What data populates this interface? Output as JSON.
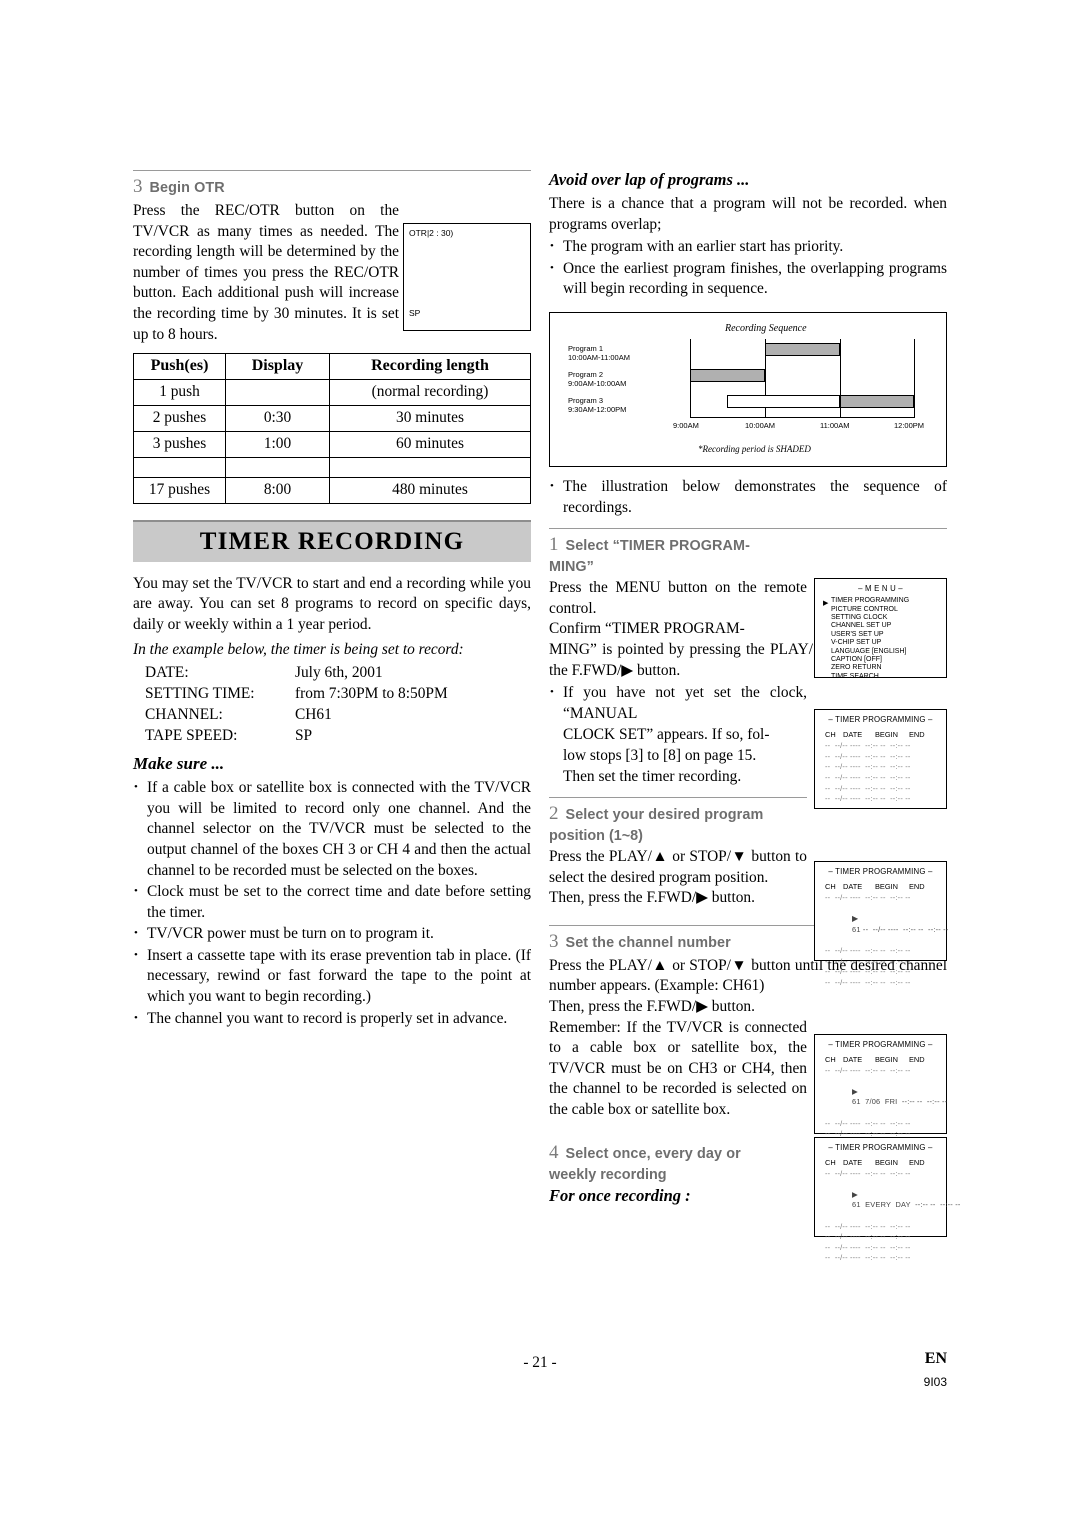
{
  "left": {
    "step3": {
      "num": "3",
      "title": "Begin OTR"
    },
    "step3_body": "Press the REC/OTR button on the TV/VCR as many times as needed. The recording length will be determined by the number of times you press the REC/OTR button. Each additional push will increase the recording time by 30 minutes. It is set up to 8 hours.",
    "otr_display": {
      "top": "OTR|2 : 30)",
      "bottom": "SP"
    },
    "table": {
      "headers": [
        "Push(es)",
        "Display",
        "Recording length"
      ],
      "rows": [
        [
          "1 push",
          "",
          "(normal recording)"
        ],
        [
          "2 pushes",
          "0:30",
          "30 minutes"
        ],
        [
          "3 pushes",
          "1:00",
          "60 minutes"
        ],
        [
          "",
          "",
          ""
        ],
        [
          "17 pushes",
          "8:00",
          "480 minutes"
        ]
      ]
    },
    "banner": "TIMER RECORDING",
    "intro": "You may set the TV/VCR to start and end a recording while you are away. You can set 8 programs to record on specific days, daily or weekly within a 1 year period.",
    "example_intro": "In the example below, the timer is being set to record:",
    "example": [
      {
        "key": "DATE:",
        "value": "July 6th, 2001"
      },
      {
        "key": "SETTING TIME:",
        "value": "from 7:30PM to 8:50PM"
      },
      {
        "key": "CHANNEL:",
        "value": "CH61"
      },
      {
        "key": "TAPE SPEED:",
        "value": "SP"
      }
    ],
    "make_sure_title": "Make sure ...",
    "make_sure_items": [
      "If a cable box or satellite box is connected with the TV/VCR you will be limited to record only one channel. And the channel selector on the TV/VCR must be selected to the output channel of the boxes CH 3 or CH 4 and then the actual channel to be recorded must be selected on the boxes.",
      "Clock must be set to the correct time and date before setting the timer.",
      "TV/VCR power must be turn on to program it.",
      "Insert a cassette tape with its erase prevention tab in place. (If necessary, rewind or fast forward the tape to the point at which you want to begin recording.)",
      "The channel you want to record is properly set in advance."
    ]
  },
  "right": {
    "avoid_title": "Avoid over lap of programs ...",
    "avoid_body": "There is a chance that a program will not be recorded. when programs overlap;",
    "avoid_items": [
      "The program with an earlier start has priority.",
      "Once the earliest program finishes, the overlapping programs will begin recording in sequence."
    ],
    "sequence": {
      "title": "Recording Sequence",
      "programs": [
        {
          "name": "Program 1",
          "time": "10:00AM-11:00AM"
        },
        {
          "name": "Program 2",
          "time": "9:00AM-10:00AM"
        },
        {
          "name": "Program 3",
          "time": "9:30AM-12:00PM"
        }
      ],
      "ticks": [
        "9:00AM",
        "10:00AM",
        "11:00AM",
        "12:00PM"
      ],
      "note": "*Recording period is SHADED"
    },
    "illustration_note": "The illustration below demonstrates the sequence of recordings.",
    "step1": {
      "num": "1",
      "title": "Select “TIMER PROGRAM-",
      "title2": "MING”"
    },
    "step1_body1": "Press the MENU button on the remote control.",
    "step1_body2": "Confirm “TIMER PROGRAMMING” is pointed by pressing the PLAY/▲ button. And press the F.FWD/▶ button.",
    "step1_bullet": "If you have not yet set the clock, “MANUAL CLOCK SET” appears. If so, follow stops [3] to [8] on page 15. Then set the timer recording.",
    "menu_osd": {
      "title": "– M E N U –",
      "items": [
        "TIMER PROGRAMMING",
        "PICTURE CONTROL",
        "SETTING CLOCK",
        "CHANNEL SET UP",
        "USER'S SET UP",
        "V-CHIP SET UP",
        "LANGUAGE [ENGLISH]",
        "CAPTION [OFF]",
        "ZERO RETURN",
        "TIME SEARCH"
      ],
      "pointer": "▶"
    },
    "step2": {
      "num": "2",
      "title": "Select your desired program",
      "title2": "position (1~8)"
    },
    "step2_body": "Press the PLAY/▲ or STOP/▼ button to select the desired program position.",
    "step2_body2": "Then, press the F.FWD/▶ button.",
    "step3": {
      "num": "3",
      "title": "Set the channel number"
    },
    "step3_body": "Press the PLAY/▲ or STOP/▼ button until the desired channel number appears. (Example: CH61)",
    "step3_body2": "Then, press the F.FWD/▶ button.",
    "step3_body3": "Remember: If the TV/VCR is connected to a cable box or satellite box, the TV/VCR must be on CH3 or CH4, then the channel to be recorded is selected on the cable box or satellite box.",
    "step4": {
      "num": "4",
      "title": "Select once, every day or",
      "title2": "weekly recording"
    },
    "step4_sub": "For once recording :",
    "timer_osd": {
      "title": "– TIMER PROGRAMMING –",
      "headers": [
        "CH",
        "DATE",
        "BEGIN",
        "END"
      ],
      "blank_row": "--  --/-- ----  --:-- --  --:-- --",
      "row_ch": "61 --  --/-- ----  --:-- --  --:-- --",
      "row_date": "61  7/06  FRI  --:-- --  --:-- --",
      "row_every": "61  EVERY  DAY  --:-- --  --:-- --"
    }
  },
  "footer": {
    "page": "- 21 -",
    "lang": "EN",
    "code": "9I03"
  }
}
